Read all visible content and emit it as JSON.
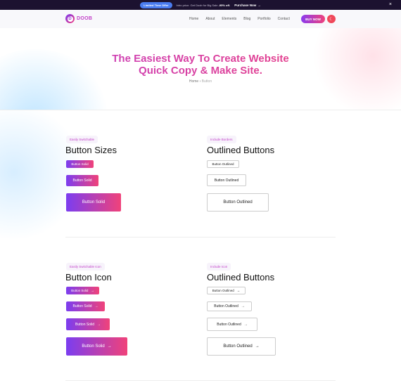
{
  "topbar": {
    "badge": "Limited Time Offer",
    "promo_text": "Intro price. Get Doob for Big Sale",
    "promo_discount": "-95% off.",
    "purchase": "Purchase Now",
    "purchase_arrow": "→",
    "close": "×"
  },
  "header": {
    "logo_letter": "D",
    "logo_text": "DOOB",
    "nav": [
      "Home",
      "About",
      "Elements",
      "Blog",
      "Portfolio",
      "Contact"
    ],
    "buy_now": "BUY NOW",
    "theme_icon": "☾"
  },
  "hero": {
    "title_line1": "The Easiest Way To Create Website",
    "title_line2": "Quick Copy & Make Site.",
    "breadcrumb_home": "Home",
    "breadcrumb_sep": "›",
    "breadcrumb_current": "Button"
  },
  "sections": {
    "sizes": {
      "tag": "Easily Switchable",
      "title": "Button Sizes",
      "buttons": [
        "Button Solid",
        "Button Solid",
        "Button Solid"
      ]
    },
    "outlined1": {
      "tag": "Include Borders",
      "title": "Outlined Buttons",
      "buttons": [
        "Button Outlined",
        "Button Outlined",
        "Button Outlined"
      ]
    },
    "icon": {
      "tag": "Easily Switchable Icon",
      "title": "Button Icon",
      "buttons": [
        "Button Solid",
        "Button Solid",
        "Button Solid",
        "Button Solid"
      ],
      "arrow": "→"
    },
    "outlined2": {
      "tag": "Include Icon",
      "title": "Outlined Buttons",
      "buttons": [
        "Button Outlined",
        "Button Outlined",
        "Button Outlined",
        "Button Outlined"
      ],
      "arrow": "→"
    }
  },
  "colors": {
    "brand_gradient_start": "#7b3df0",
    "brand_gradient_end": "#f0427a",
    "topbar_bg": "#1c1230",
    "badge_blue": "#4a7cf0"
  }
}
